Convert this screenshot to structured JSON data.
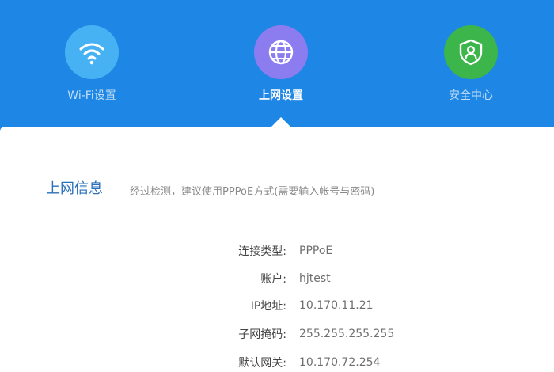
{
  "nav": {
    "items": [
      {
        "label": "Wi-Fi设置",
        "icon": "wifi-icon",
        "color": "#47b2f3"
      },
      {
        "label": "上网设置",
        "icon": "globe-icon",
        "color": "#8b7cf0",
        "active": true
      },
      {
        "label": "安全中心",
        "icon": "shield-user-icon",
        "color": "#3cb54a"
      }
    ]
  },
  "section": {
    "title": "上网信息",
    "hint": "经过检测，建议使用PPPoE方式(需要输入帐号与密码)"
  },
  "info": [
    {
      "label": "连接类型:",
      "value": "PPPoE"
    },
    {
      "label": "账户:",
      "value": "hjtest"
    },
    {
      "label": "IP地址:",
      "value": "10.170.11.21"
    },
    {
      "label": "子网掩码:",
      "value": "255.255.255.255"
    },
    {
      "label": "默认网关:",
      "value": "10.170.72.254"
    }
  ],
  "colors": {
    "header_bg": "#1e86e4",
    "title_color": "#2a6fb8"
  }
}
